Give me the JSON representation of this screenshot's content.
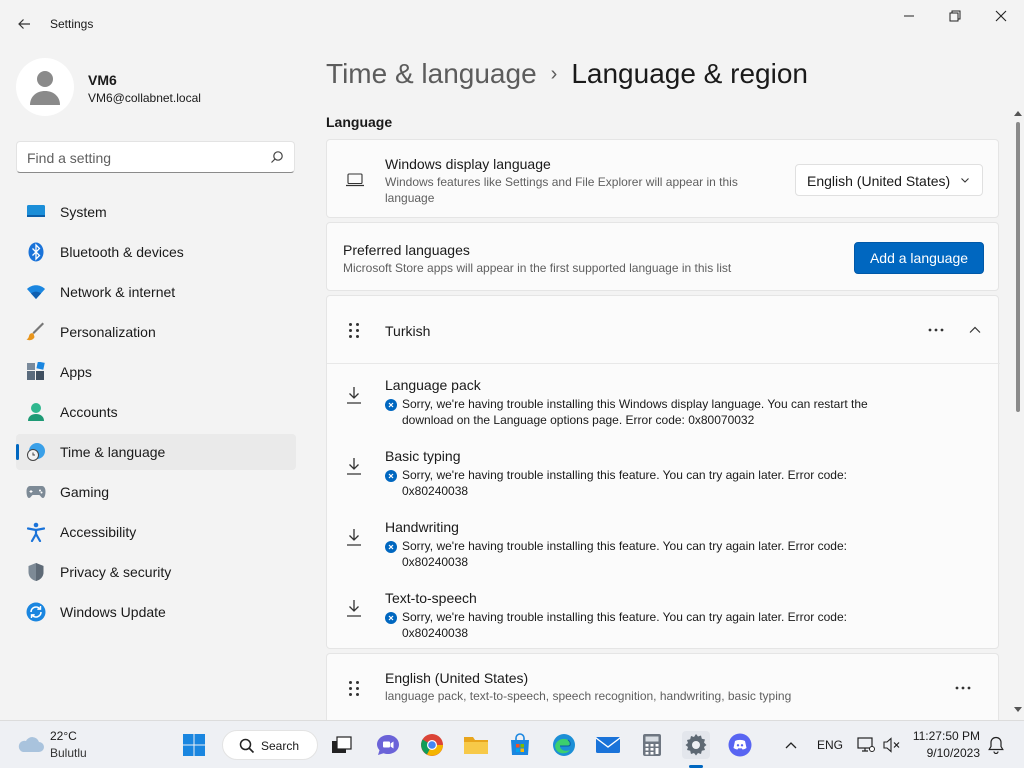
{
  "window": {
    "title": "Settings",
    "controls": {
      "minimize": "minimize",
      "maximize": "maximize",
      "close": "close"
    }
  },
  "profile": {
    "name": "VM6",
    "email": "VM6@collabnet.local"
  },
  "search": {
    "placeholder": "Find a setting"
  },
  "sidebar": {
    "items": [
      {
        "label": "System",
        "icon": "system-icon"
      },
      {
        "label": "Bluetooth & devices",
        "icon": "bluetooth-icon"
      },
      {
        "label": "Network & internet",
        "icon": "wifi-icon"
      },
      {
        "label": "Personalization",
        "icon": "brush-icon"
      },
      {
        "label": "Apps",
        "icon": "apps-icon"
      },
      {
        "label": "Accounts",
        "icon": "accounts-icon"
      },
      {
        "label": "Time & language",
        "icon": "time-language-icon",
        "active": true
      },
      {
        "label": "Gaming",
        "icon": "gamepad-icon"
      },
      {
        "label": "Accessibility",
        "icon": "accessibility-icon"
      },
      {
        "label": "Privacy & security",
        "icon": "shield-icon"
      },
      {
        "label": "Windows Update",
        "icon": "update-icon"
      }
    ]
  },
  "breadcrumb": {
    "parent": "Time & language",
    "separator": "›",
    "current": "Language & region"
  },
  "main": {
    "section_title": "Language",
    "display_language": {
      "title": "Windows display language",
      "description": "Windows features like Settings and File Explorer will appear in this language",
      "selected": "English (United States)"
    },
    "preferred": {
      "title": "Preferred languages",
      "description": "Microsoft Store apps will appear in the first supported language in this list",
      "add_button": "Add a language"
    },
    "turkish": {
      "name": "Turkish",
      "features": [
        {
          "title": "Language pack",
          "message": "Sorry, we're having trouble installing this Windows display language. You can restart the download on the Language options page. Error code: 0x80070032"
        },
        {
          "title": "Basic typing",
          "message": "Sorry, we're having trouble installing this feature. You can try again later. Error code: 0x80240038"
        },
        {
          "title": "Handwriting",
          "message": "Sorry, we're having trouble installing this feature. You can try again later. Error code: 0x80240038"
        },
        {
          "title": "Text-to-speech",
          "message": "Sorry, we're having trouble installing this feature. You can try again later. Error code: 0x80240038"
        }
      ]
    },
    "english": {
      "name": "English (United States)",
      "description": "language pack, text-to-speech, speech recognition, handwriting, basic typing"
    }
  },
  "taskbar": {
    "weather": {
      "temp": "22°C",
      "desc": "Bulutlu"
    },
    "search_label": "Search",
    "language": "ENG",
    "time": "11:27:50 PM",
    "date": "9/10/2023"
  },
  "colors": {
    "accent": "#0067c0",
    "background": "#f3f3f3",
    "card": "#fbfbfb"
  }
}
